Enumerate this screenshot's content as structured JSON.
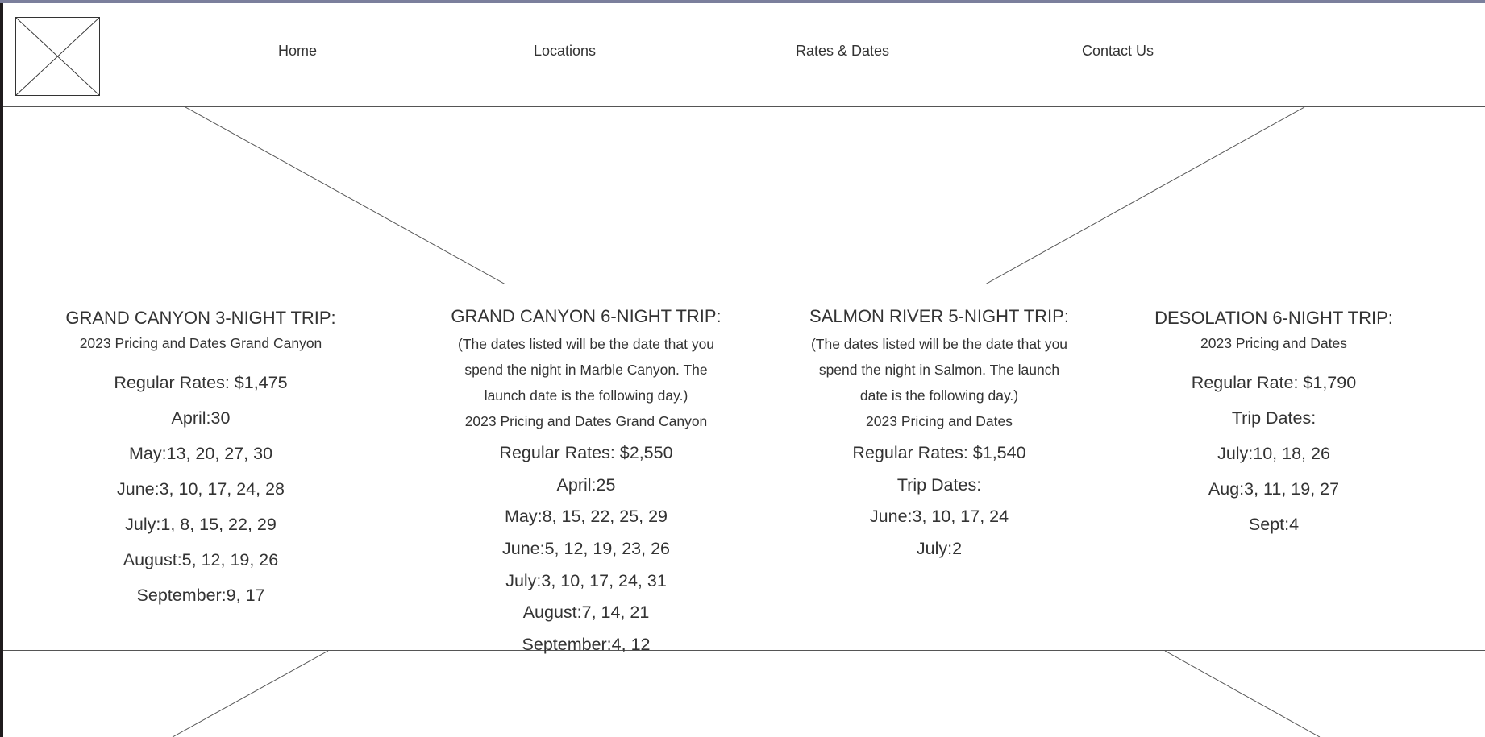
{
  "nav": {
    "links": [
      "Home",
      "Locations",
      "Rates & Dates",
      "Contact Us"
    ]
  },
  "trips": [
    {
      "title": "GRAND CANYON 3-NIGHT TRIP:",
      "note": [],
      "subtitle": "2023 Pricing and Dates Grand Canyon",
      "rate": "Regular Rates: $1,475",
      "dates": [
        "April:30",
        "May:13, 20, 27, 30",
        "June:3, 10, 17, 24, 28",
        "July:1, 8, 15, 22, 29",
        "August:5, 12, 19, 26",
        "September:9, 17"
      ]
    },
    {
      "title": "GRAND CANYON 6-NIGHT TRIP:",
      "note": [
        "(The dates listed will be the date that you",
        "spend the night in Marble Canyon. The",
        "launch date is the following day.)"
      ],
      "subtitle": "2023 Pricing and Dates Grand Canyon",
      "rate": "Regular Rates: $2,550",
      "dates": [
        "April:25",
        "May:8, 15, 22, 25, 29",
        "June:5, 12, 19, 23, 26",
        "July:3, 10, 17, 24, 31",
        "August:7, 14, 21",
        "September:4, 12"
      ]
    },
    {
      "title": "SALMON RIVER 5-NIGHT TRIP:",
      "note": [
        "(The dates listed will be the date that you",
        "spend the night in Salmon. The launch",
        "date is the following day.)"
      ],
      "subtitle": "2023 Pricing and Dates",
      "rate": "Regular Rates: $1,540",
      "dates": [
        "Trip Dates:",
        "June:3, 10, 17, 24",
        "July:2"
      ]
    },
    {
      "title": "DESOLATION 6-NIGHT TRIP:",
      "note": [],
      "subtitle": "2023 Pricing and Dates",
      "rate": "Regular Rate: $1,790",
      "dates": [
        "Trip Dates:",
        "July:10, 18, 26",
        "Aug:3, 11, 19, 27",
        "Sept:4"
      ]
    }
  ],
  "colors": {
    "text": "#333333",
    "lines": "#555555",
    "background": "#ffffff"
  },
  "icons": {
    "logo": "image-placeholder-icon"
  }
}
